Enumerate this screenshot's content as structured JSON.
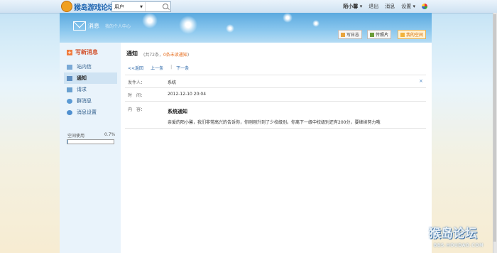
{
  "site": {
    "logo_text": "猴岛游戏论坛"
  },
  "search": {
    "scope": "用户",
    "caret": "▼"
  },
  "topnav": {
    "username": "陌小馨 ▾",
    "logout": "退出",
    "messages": "消息",
    "settings": "设置 ▾"
  },
  "header": {
    "title": "消息",
    "subtitle": "我的个人中心",
    "buttons": [
      "写日志",
      "传照片",
      "我的空间"
    ]
  },
  "sidebar": {
    "compose": "写新消息",
    "items": [
      "站内信",
      "通知",
      "请求",
      "群消息",
      "消息设置"
    ],
    "active_index": 1,
    "space_label": "空间使用",
    "space_percent": "0.7%",
    "space_fraction": 0.007
  },
  "main": {
    "title": "通知",
    "count_prefix": "(共72条，",
    "count_unread": "0条未读通知",
    "count_suffix": ")",
    "back": "<<返回",
    "prev": "上一条",
    "sep": "|",
    "next": "下一条",
    "close": "×",
    "sender_label": "发件人：",
    "sender_value": "系统",
    "time_label": "时　间：",
    "time_value": "2012-12-10 20:04",
    "content_label": "内　容：",
    "content_title": "系统通知",
    "content_body": "亲爱的陌小馨，我们非常高兴的告诉你，你刚刚升到了少校级别。你离下一级中校级别还有200分，要继续努力哦"
  },
  "watermark": {
    "main": "猴岛论坛",
    "sub": "BBS.HOUDAO.COM"
  },
  "colors": {
    "accent": "#2462a6",
    "header": "#5aa9df",
    "orange": "#e66b1a"
  }
}
